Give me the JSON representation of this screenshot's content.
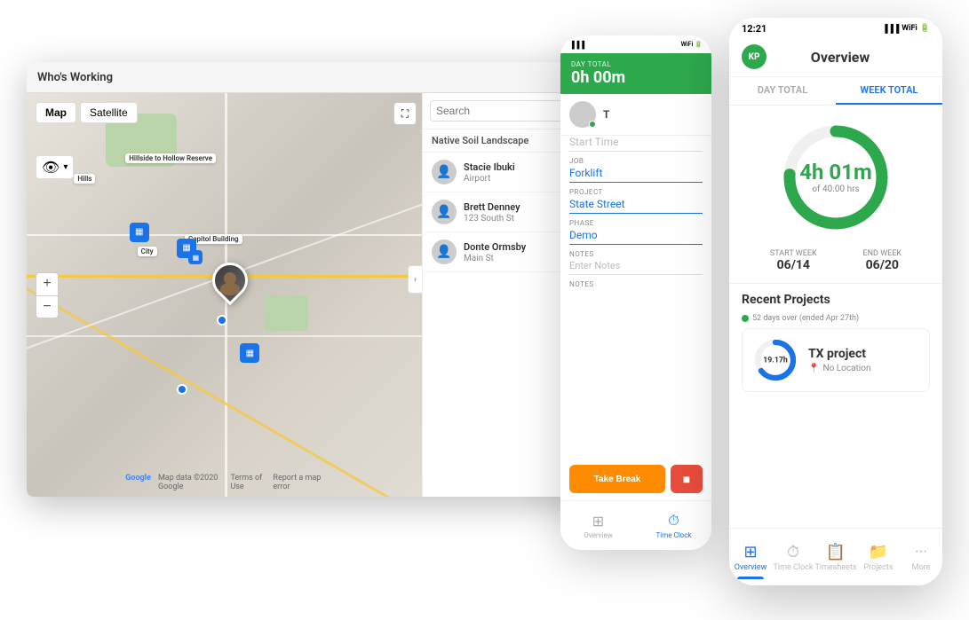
{
  "window": {
    "title": "Who's Working",
    "help_label": "?"
  },
  "map": {
    "tab_map": "Map",
    "tab_satellite": "Satellite",
    "zoom_in": "+",
    "zoom_out": "−",
    "attribution": "Map data ©2020 Google  Terms of Use  Report a map error",
    "google_label": "Google"
  },
  "sidebar": {
    "search_placeholder": "Search",
    "filter_icon": "≡",
    "company": "Native Soil Landscape",
    "users": [
      {
        "name": "Stacie Ibuki",
        "location": "Airport"
      },
      {
        "name": "Brett Denney",
        "location": "123 South St"
      },
      {
        "name": "Donte Ormsby",
        "location": "Main St"
      }
    ]
  },
  "phone1": {
    "status_time": "",
    "signal": "▐▐▐",
    "wifi": "WiFi",
    "day_total_label": "DAY TOTAL",
    "day_total_value": "0h 00m",
    "tab_label": "T",
    "start_time_label": "Start Time",
    "job_label": "JOB",
    "job_value": "Forklift",
    "project_label": "PROJECT",
    "project_value": "State Street",
    "phase_label": "PHASE",
    "phase_value": "Demo",
    "notes_label": "NOTES",
    "notes_placeholder": "Enter Notes",
    "notes2_label": "NOTES",
    "break_btn": "Take Break",
    "stop_btn": "■",
    "nav": {
      "overview_icon": "⊞",
      "overview_label": "Overview",
      "timeclock_icon": "⏱",
      "timeclock_label": "Time Clock"
    }
  },
  "phone2": {
    "time": "12:21",
    "signal": "●●●",
    "wifi": "WiFi",
    "battery": "Battery",
    "avatar_initials": "KP",
    "page_title": "Overview",
    "tab_day": "DAY TOTAL",
    "tab_week": "WEEK TOTAL",
    "donut_time": "4h 01m",
    "donut_subtitle": "of 40.00 hrs",
    "week_start_label": "Start Week",
    "week_start_value": "06/14",
    "week_end_label": "End Week",
    "week_end_value": "06/20",
    "recent_title": "Recent Projects",
    "recent_badge": "52 days over (ended Apr 27th)",
    "project_name": "TX  project",
    "project_location": "No Location",
    "project_hours": "19.17h",
    "nav": {
      "overview": "Overview",
      "timeclock": "Time Clock",
      "timesheets": "Timesheets",
      "projects": "Projects",
      "more": "More"
    }
  }
}
